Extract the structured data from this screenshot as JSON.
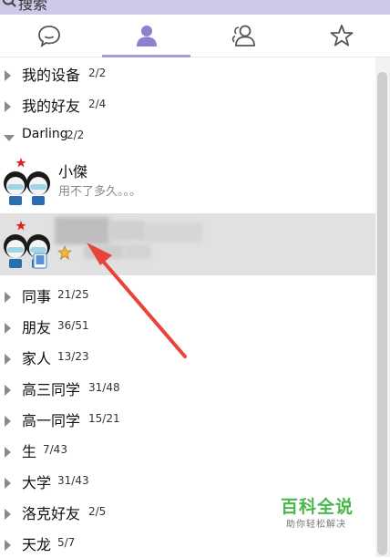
{
  "search": {
    "label": "搜索",
    "icon": "search-icon"
  },
  "tabs": [
    {
      "icon": "message-icon",
      "active": false
    },
    {
      "icon": "contacts-icon",
      "active": true
    },
    {
      "icon": "group-icon",
      "active": false
    },
    {
      "icon": "star-icon",
      "active": false
    }
  ],
  "groups": {
    "my_devices": {
      "name": "我的设备",
      "count": "2/2"
    },
    "my_friends": {
      "name": "我的好友",
      "count": "2/4"
    },
    "darling": {
      "name": "Darling",
      "count": "2/2"
    },
    "coworkers": {
      "name": "同事",
      "count": "21/25"
    },
    "friends": {
      "name": "朋友",
      "count": "36/51"
    },
    "family": {
      "name": "家人",
      "count": "13/23"
    },
    "senior3": {
      "name": "高三同学",
      "count": "31/48"
    },
    "senior1": {
      "name": "高一同学",
      "count": "15/21"
    },
    "sheng": {
      "name": "生",
      "count": "7/43"
    },
    "university": {
      "name": "大学",
      "count": "31/43"
    },
    "luoke": {
      "name": "洛克好友",
      "count": "2/5"
    },
    "tianlong": {
      "name": "天龙",
      "count": "5/7"
    }
  },
  "contacts": [
    {
      "name": "小傑",
      "signature": "用不了多久。。。"
    }
  ],
  "watermark": {
    "title": "百科全说",
    "subtitle": "助你轻松解决"
  },
  "colors": {
    "search_bg": "#cfc8e8",
    "tab_active": "#a89ad8",
    "annotation_arrow": "#e8443a",
    "watermark_green": "#49b84a"
  }
}
